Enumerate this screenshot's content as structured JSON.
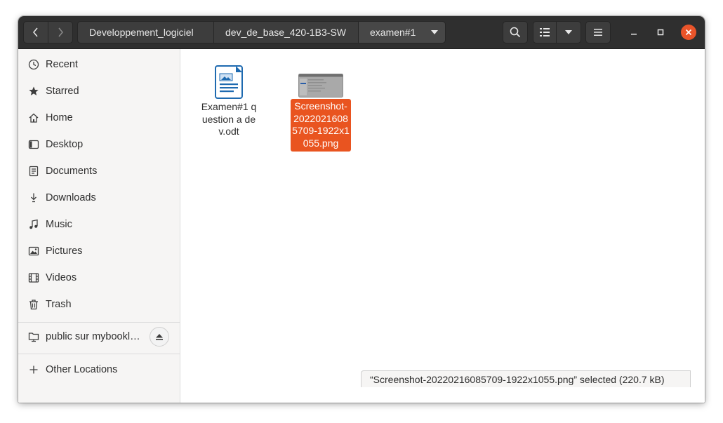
{
  "breadcrumbs": [
    "Developpement_logiciel",
    "dev_de_base_420-1B3-SW",
    "examen#1"
  ],
  "sidebar": {
    "items": [
      {
        "label": "Recent",
        "icon": "clock-icon"
      },
      {
        "label": "Starred",
        "icon": "star-icon"
      },
      {
        "label": "Home",
        "icon": "home-icon"
      },
      {
        "label": "Desktop",
        "icon": "desktop-icon"
      },
      {
        "label": "Documents",
        "icon": "document-icon"
      },
      {
        "label": "Downloads",
        "icon": "download-icon"
      },
      {
        "label": "Music",
        "icon": "music-icon"
      },
      {
        "label": "Pictures",
        "icon": "picture-icon"
      },
      {
        "label": "Videos",
        "icon": "video-icon"
      },
      {
        "label": "Trash",
        "icon": "trash-icon"
      }
    ],
    "network": {
      "label": "public sur mybookl…",
      "icon": "network-folder-icon"
    },
    "other": {
      "label": "Other Locations",
      "icon": "plus-icon"
    }
  },
  "files": [
    {
      "name": "Examen#1 question a dev.odt",
      "type": "odt-document",
      "selected": false
    },
    {
      "name": "Screenshot-20220216085709-1922x1055.png",
      "type": "png-image",
      "selected": true
    }
  ],
  "status": {
    "text": "“Screenshot-20220216085709-1922x1055.png” selected  (220.7 kB)"
  },
  "colors": {
    "accent": "#e95420",
    "headerbar": "#2f2f2f",
    "close": "#e9542a"
  }
}
